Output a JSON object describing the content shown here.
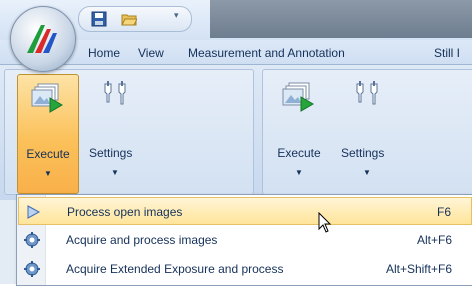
{
  "tabs": [
    "Home",
    "View",
    "Measurement and Annotation",
    "Still I"
  ],
  "ribbon": {
    "groups": [
      {
        "execute_label": "Execute",
        "settings_label": "Settings",
        "execute_active": true
      },
      {
        "execute_label": "Execute",
        "settings_label": "Settings",
        "execute_active": false
      }
    ]
  },
  "menu": {
    "items": [
      {
        "label": "Process open images",
        "shortcut": "F6",
        "icon": "play-triangle-icon",
        "highlighted": true
      },
      {
        "label": "Acquire and process images",
        "shortcut": "Alt+F6",
        "icon": "gear-icon",
        "highlighted": false
      },
      {
        "label": "Acquire Extended Exposure and process",
        "shortcut": "Alt+Shift+F6",
        "icon": "gear-icon",
        "highlighted": false
      }
    ]
  },
  "colors": {
    "active_button": "#fbc15a",
    "menu_highlight": "#ffe49a",
    "ribbon_bg": "#d3e1f2",
    "text": "#15315a"
  }
}
